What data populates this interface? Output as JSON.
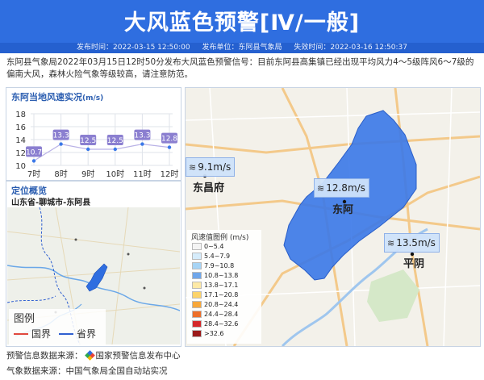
{
  "header": {
    "title": "大风蓝色预警[Ⅳ/一般]",
    "issue_time": "发布时间：2022-03-15 12:50:00",
    "issuer": "发布单位：东阿县气象局",
    "expire_time": "失效时间：2022-03-16 12:50:37"
  },
  "description": "东阿县气象局2022年03月15日12时50分发布大风蓝色预警信号：目前东阿县高集镇已经出现平均风力4～5级阵风6～7级的偏南大风，森林火险气象等级较高，请注意防范。",
  "wind_panel": {
    "title": "东阿当地风速实况",
    "unit": "(m/s)"
  },
  "chart_data": {
    "type": "line",
    "title": "东阿当地风速实况",
    "ylabel": "(m/s)",
    "categories": [
      "7时",
      "8时",
      "9时",
      "10时",
      "11时",
      "12时"
    ],
    "values": [
      10.7,
      13.3,
      12.5,
      12.5,
      13.3,
      12.8
    ],
    "yticks": [
      10,
      12,
      14,
      16,
      18
    ],
    "ylim": [
      10,
      18
    ],
    "grid": true,
    "series_color": "#8b7fd0"
  },
  "location": {
    "title": "定位概览",
    "region": "山东省-聊城市-东阿县",
    "legend_title": "图例",
    "legend_items": [
      {
        "label": "国界",
        "color": "#e0483e"
      },
      {
        "label": "省界",
        "color": "#2f5fd0"
      }
    ]
  },
  "map": {
    "legend_title": "风速值图例 (m/s)",
    "legend": [
      {
        "label": "0~5.4",
        "color": "#f4f4f4"
      },
      {
        "label": "5.4~7.9",
        "color": "#d6ecfb"
      },
      {
        "label": "7.9~10.8",
        "color": "#a7d4f5"
      },
      {
        "label": "10.8~13.8",
        "color": "#6fa6ea"
      },
      {
        "label": "13.8~17.1",
        "color": "#fde9a6"
      },
      {
        "label": "17.1~20.8",
        "color": "#fcd36a"
      },
      {
        "label": "20.8~24.4",
        "color": "#f7a739"
      },
      {
        "label": "24.4~28.4",
        "color": "#ed6f2a"
      },
      {
        "label": "28.4~32.6",
        "color": "#d4282a"
      },
      {
        "label": ">32.6",
        "color": "#9b1a1a"
      }
    ],
    "stations": [
      {
        "name": "东昌府",
        "speed": "9.1m/s"
      },
      {
        "name": "东阿",
        "speed": "12.8m/s"
      },
      {
        "name": "平阴",
        "speed": "13.5m/s"
      }
    ]
  },
  "footer": {
    "source_label": "预警信息数据来源：",
    "source_name": "国家预警信息发布中心",
    "weather_source": "气象数据来源：中国气象局全国自动站实况"
  }
}
